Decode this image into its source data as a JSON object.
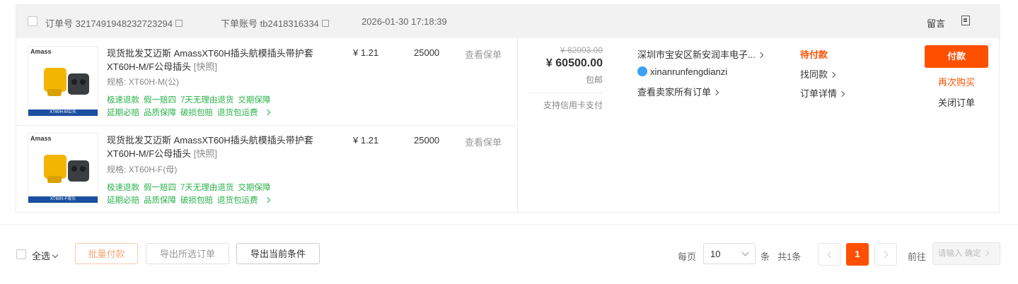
{
  "order": {
    "order_no_label": "订单号",
    "order_no": "3217491948232723294",
    "buyer_label": "下单账号",
    "buyer": "tb2418316334",
    "time": "2026-01-30 17:18:39",
    "message_label": "留言",
    "items": [
      {
        "title": "现货批发艾迈斯 AmassXT60H插头航模插头带护套XT60H-M/F公母插头",
        "tag": "[快照]",
        "spec": "规格: XT60H-M(公)",
        "thumb_brand": "Amass",
        "thumb_caption": "XT60H-M公头",
        "price": "¥ 1.21",
        "qty": "25000",
        "policy": "查看保单",
        "services_row1": [
          "极速退款",
          "假一赔四",
          "7天无理由退货",
          "交期保障"
        ],
        "services_row2": [
          "延期必赔",
          "品质保障",
          "破损包赔",
          "退货包运费"
        ]
      },
      {
        "title": "现货批发艾迈斯 AmassXT60H插头航模插头带护套XT60H-M/F公母插头",
        "tag": "[快照]",
        "spec": "规格: XT60H-F(母)",
        "thumb_brand": "Amass",
        "thumb_caption": "XT60H-F母头",
        "price": "¥ 1.21",
        "qty": "25000",
        "policy": "查看保单",
        "services_row1": [
          "极速退款",
          "假一赔四",
          "7天无理由退货",
          "交期保障"
        ],
        "services_row2": [
          "延期必赔",
          "品质保障",
          "破损包赔",
          "退货包运费"
        ]
      }
    ],
    "total": {
      "original": "¥ 82003.00",
      "amount": "¥ 60500.00",
      "shipping": "包邮",
      "credit": "支持信用卡支付"
    },
    "seller": {
      "shop": "深圳市宝安区新安润丰电子...",
      "wangwang": "xinanrunfengdianzi",
      "all_orders": "查看卖家所有订单"
    },
    "status": {
      "label": "待付款",
      "similar": "找同款",
      "detail": "订单详情"
    },
    "actions": {
      "pay": "付款",
      "rebuy": "再次购买",
      "close": "关闭订单"
    }
  },
  "footer": {
    "select_all": "全选",
    "batch_pay": "批量付款",
    "export_selected": "导出所选订单",
    "export_current": "导出当前条件",
    "per_page_label": "每页",
    "per_page_value": "10",
    "per_page_unit": "条",
    "total": "共1条",
    "current_page": "1",
    "goto_label": "前往",
    "goto_placeholder": "请输入 确定"
  },
  "colors": {
    "accent": "#ff5000",
    "service_green": "#2bb14b"
  }
}
